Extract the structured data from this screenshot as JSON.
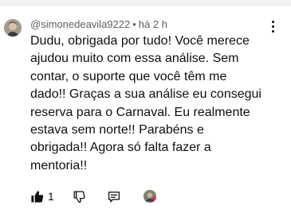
{
  "comment": {
    "author": "@simonedeavila9222",
    "separator": "•",
    "time": "há 2 h",
    "text_lines": [
      "Dudu, obrigada por tudo! Você merece",
      "ajudou muito com essa análise. Sem",
      "contar, o suporte que você têm me",
      "dado!! Graças a sua análise eu consegui",
      "reserva para o Carnaval. Eu realmente",
      "estava sem norte!! Parabéns e",
      "obrigada!! Agora só falta fazer a",
      "mentoria!!"
    ],
    "like_count": "1",
    "heart_glyph": "♥"
  },
  "icons": {
    "like": "thumbs-up-filled-icon",
    "dislike": "thumbs-down-icon",
    "reply": "reply-comment-icon",
    "menu": "more-vertical-icon",
    "creator_heart": "heart-icon"
  },
  "colors": {
    "text": "#0f0f0f",
    "meta": "#606060",
    "heart": "#e0245e"
  }
}
